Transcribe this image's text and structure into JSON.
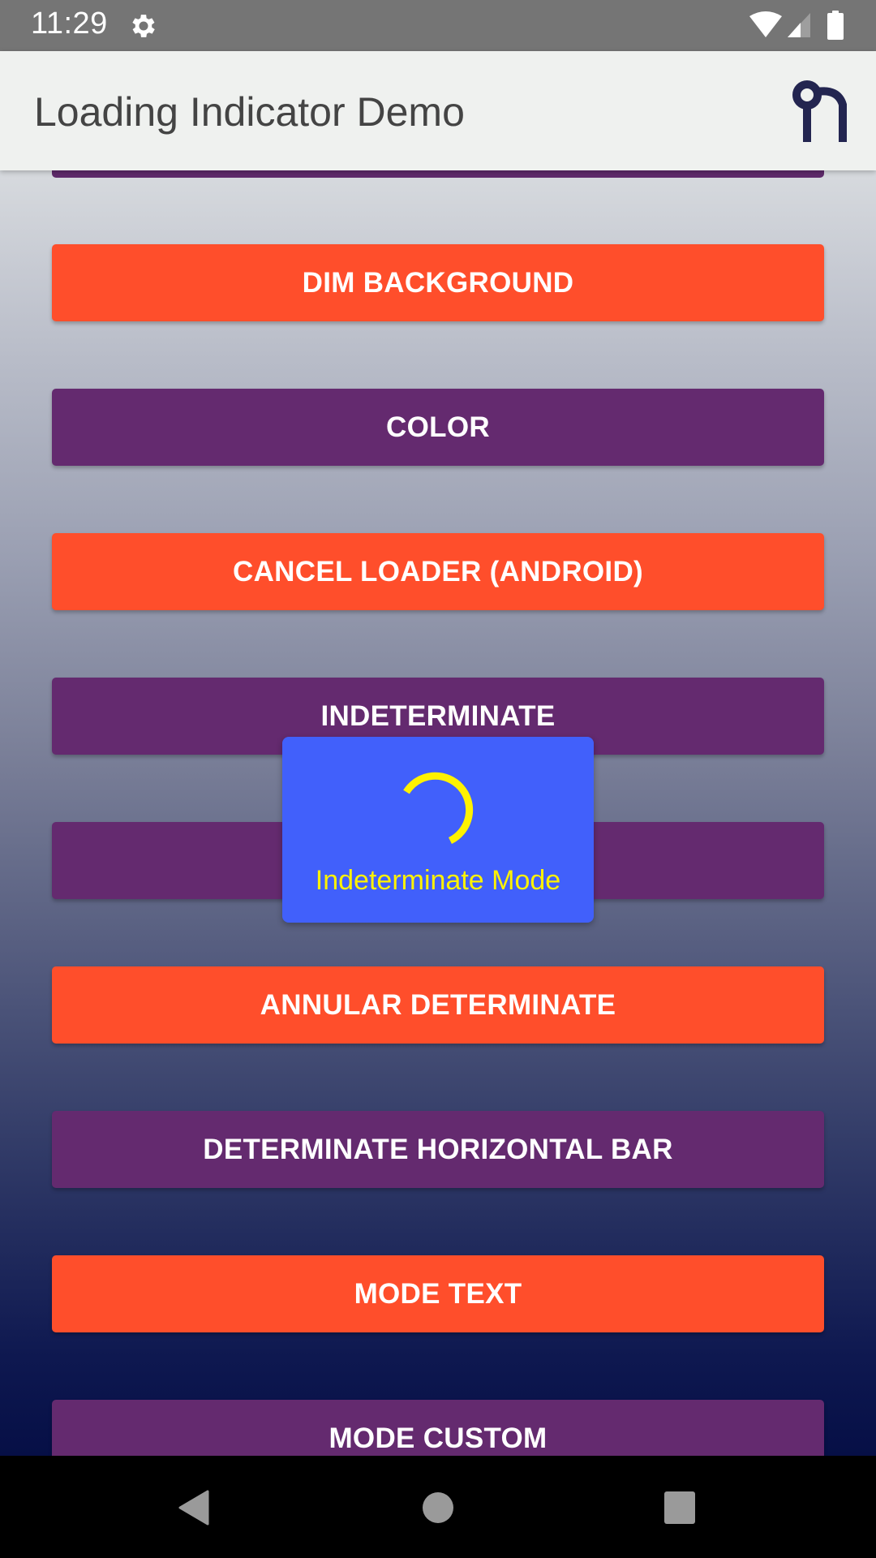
{
  "status_bar": {
    "time": "11:29",
    "icons": [
      "settings-gear-icon",
      "wifi-icon",
      "cell-signal-icon",
      "battery-icon"
    ]
  },
  "app_bar": {
    "title": "Loading Indicator Demo",
    "logo": "n-logo-icon"
  },
  "colors": {
    "orange_button": "#ff4e2b",
    "purple_button": "#642a6f",
    "loader_background": "#4160fb",
    "loader_accent": "#fff200",
    "app_bar": "#eff1ef",
    "logo": "#232550"
  },
  "buttons": [
    {
      "label": "",
      "color": "purple",
      "partially_hidden": true
    },
    {
      "label": "DIM BACKGROUND",
      "color": "orange"
    },
    {
      "label": "COLOR",
      "color": "purple"
    },
    {
      "label": "CANCEL LOADER (ANDROID)",
      "color": "orange"
    },
    {
      "label": "INDETERMINATE",
      "color": "purple"
    },
    {
      "label": "",
      "color": "purple",
      "obscured_by_loader": true
    },
    {
      "label": "ANNULAR DETERMINATE",
      "color": "orange"
    },
    {
      "label": "DETERMINATE HORIZONTAL BAR",
      "color": "purple"
    },
    {
      "label": "MODE TEXT",
      "color": "orange"
    },
    {
      "label": "MODE CUSTOM",
      "color": "purple"
    }
  ],
  "loader": {
    "label": "Indeterminate Mode",
    "mode": "indeterminate",
    "icon": "spinner-arc-icon"
  },
  "nav_bar": {
    "back": "back-triangle-icon",
    "home": "home-circle-icon",
    "recents": "recents-square-icon"
  }
}
